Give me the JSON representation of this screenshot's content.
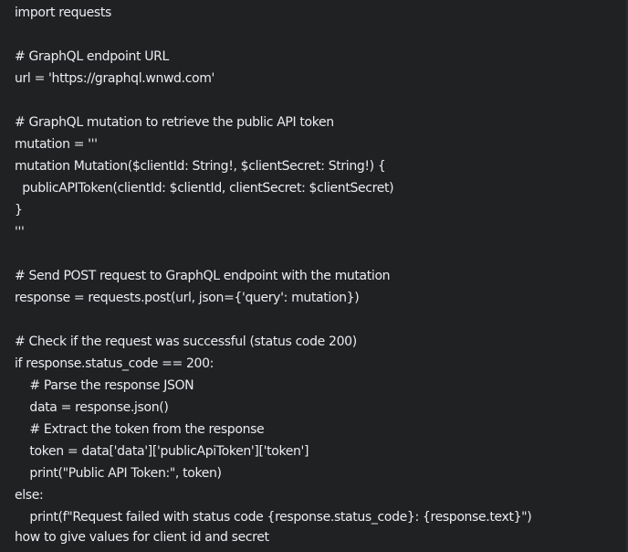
{
  "code_block": {
    "lines": [
      "import requests",
      "",
      "# GraphQL endpoint URL",
      "url = 'https://graphql.wnwd.com'",
      "",
      "# GraphQL mutation to retrieve the public API token",
      "mutation = '''",
      "mutation Mutation($clientId: String!, $clientSecret: String!) {",
      "  publicAPIToken(clientId: $clientId, clientSecret: $clientSecret)",
      "}",
      "'''",
      "",
      "# Send POST request to GraphQL endpoint with the mutation",
      "response = requests.post(url, json={'query': mutation})",
      "",
      "# Check if the request was successful (status code 200)",
      "if response.status_code == 200:",
      "    # Parse the response JSON",
      "    data = response.json()",
      "    # Extract the token from the response",
      "    token = data['data']['publicApiToken']['token']",
      "    print(\"Public API Token:\", token)",
      "else:",
      "    print(f\"Request failed with status code {response.status_code}: {response.text}\")"
    ]
  },
  "user_question": "how to give values for client id and secret",
  "colors": {
    "background": "#202123",
    "text": "#ececf1"
  }
}
